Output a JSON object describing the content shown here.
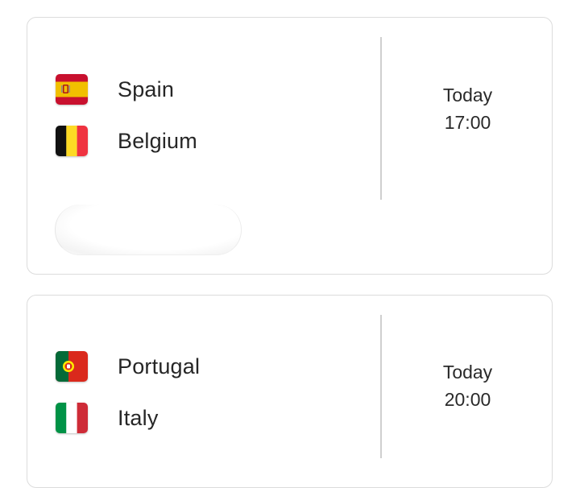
{
  "matches": [
    {
      "home": {
        "name": "Spain",
        "flag": "spain-flag-icon"
      },
      "away": {
        "name": "Belgium",
        "flag": "belgium-flag-icon"
      },
      "day": "Today",
      "time": "17:00"
    },
    {
      "home": {
        "name": "Portugal",
        "flag": "portugal-flag-icon"
      },
      "away": {
        "name": "Italy",
        "flag": "italy-flag-icon"
      },
      "day": "Today",
      "time": "20:00"
    }
  ],
  "colors": {
    "card_border": "#dcdcdc",
    "divider": "#cfcfcf",
    "text": "#262626"
  }
}
